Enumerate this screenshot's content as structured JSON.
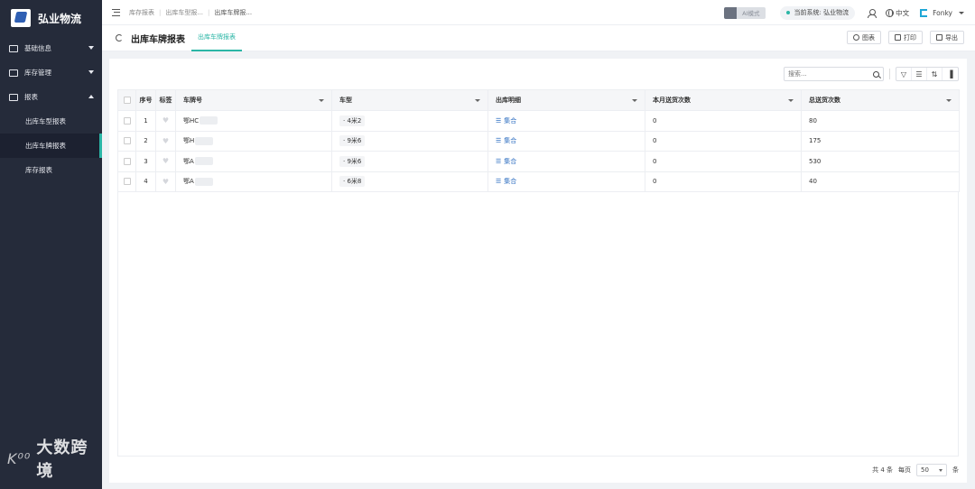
{
  "brand": {
    "name": "弘业物流"
  },
  "sidebar": {
    "items": [
      {
        "label": "基础信息",
        "icon": "grid-icon",
        "expanded": false
      },
      {
        "label": "库存管理",
        "icon": "box-icon",
        "expanded": false
      },
      {
        "label": "报表",
        "icon": "report-icon",
        "expanded": true
      }
    ],
    "sub_items": [
      {
        "label": "出库车型报表",
        "active": false
      },
      {
        "label": "出库车牌报表",
        "active": true
      },
      {
        "label": "库存报表",
        "active": false
      }
    ]
  },
  "watermark": {
    "text": "大数跨境",
    "mark": "K⁰⁰"
  },
  "topbar": {
    "breadcrumbs": [
      "库存报表",
      "出库车型报...",
      "出库车牌报..."
    ],
    "ai_mode": "AI模式",
    "system_label": "当前系统: 弘业物流",
    "language": "中文",
    "username": "Fonky"
  },
  "titlebar": {
    "title": "出库车牌报表",
    "active_tab": "出库车牌报表",
    "actions": {
      "chart": "图表",
      "print": "打印",
      "export": "导出"
    }
  },
  "toolbar": {
    "search_placeholder": "搜索..."
  },
  "table": {
    "columns": {
      "index": "序号",
      "tag": "标签",
      "plate": "车牌号",
      "type": "车型",
      "detail": "出库明细",
      "month_count": "本月送货次数",
      "total_count": "总送货次数"
    },
    "rows": [
      {
        "index": "1",
        "plate": "鄂HC",
        "type": "4米2",
        "detail": "集合",
        "month_count": "0",
        "total_count": "80"
      },
      {
        "index": "2",
        "plate": "鄂H",
        "type": "9米6",
        "detail": "集合",
        "month_count": "0",
        "total_count": "175"
      },
      {
        "index": "3",
        "plate": "鄂A",
        "type": "9米6",
        "detail": "集合",
        "month_count": "0",
        "total_count": "530"
      },
      {
        "index": "4",
        "plate": "鄂A",
        "type": "6米8",
        "detail": "集合",
        "month_count": "0",
        "total_count": "40"
      }
    ]
  },
  "pager": {
    "total": "共 4 条",
    "per_page_label": "每页",
    "page_size": "50",
    "unit": "条"
  },
  "colors": {
    "sidebar_bg": "#252b3a",
    "accent": "#2bb6a6",
    "link": "#2f6fc1"
  }
}
